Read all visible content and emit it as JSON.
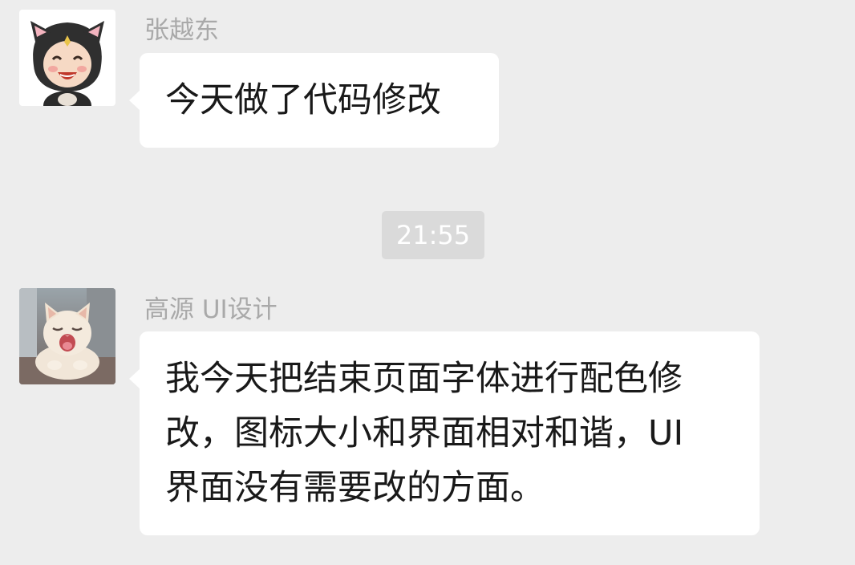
{
  "messages": [
    {
      "sender": "张越东",
      "avatar_icon": "cartoon-cat-hood-avatar",
      "lines": [
        "今天做了代码修改"
      ]
    },
    {
      "sender": "高源 UI设计",
      "avatar_icon": "yawning-cat-photo-avatar",
      "lines": [
        "我今天把结束页面字体进行配色修",
        "改，图标大小和界面相对和谐，UI",
        "界面没有需要改的方面。"
      ]
    }
  ],
  "timestamp": "21:55",
  "colors": {
    "background": "#ededed",
    "bubble": "#ffffff",
    "sender_name": "#a9a9a9",
    "time_pill": "#dadada",
    "message_text": "#191919"
  }
}
